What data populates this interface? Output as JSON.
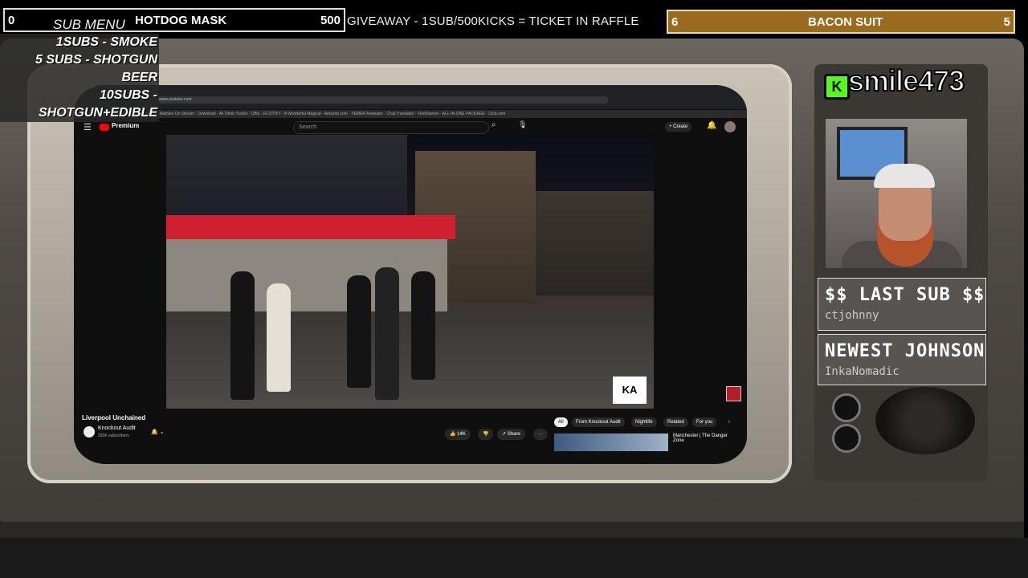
{
  "overlay": {
    "top_left": {
      "count": "0",
      "title": "HOTDOG MASK",
      "goal": "500",
      "submenu_title": "SUB MENU"
    },
    "submenu_items": [
      "1SUBS   - SMOKE",
      "5 SUBS  - SHOTGUN BEER",
      "10SUBS - SHOTGUN+EDIBLE"
    ],
    "ticker": "GIVEAWAY - 1SUB/500KICKS = TICKET IN RAFFLE",
    "top_right": {
      "count": "6",
      "title": "BACON SUIT",
      "goal": "5"
    },
    "streamer_name": "smile473",
    "kick_logo": "K",
    "last_sub": {
      "heading": "$$ LAST SUB $$",
      "name": "ctjohnny"
    },
    "newest": {
      "heading": "NEWEST JOHNSON",
      "name": "InkaNomadic"
    }
  },
  "browser": {
    "url": "www.youtube.com",
    "bookmarks": "Creator Dashboard · Neppis: The magic of · Marbles On Stream · Download · All Other Tracks · OBS · ECOTIXY · A Wonderful Magical · Amazon.com · YEMEN Repeater · Chat Translator · FirstOpener · ALL-IN-ONE PACKAGE · Club.com"
  },
  "youtube": {
    "logo_text": "Premium",
    "search_placeholder": "Search",
    "create_label": "+ Create",
    "video_badge": "KA",
    "video_title": "Liverpool Unchained",
    "channel_name": "Knockout Audit",
    "channel_subs": "293K subscribers",
    "likes": "14K",
    "share_label": "Share",
    "more_label": "···",
    "chips": [
      "All",
      "From Knockout Audit",
      "Nightlife",
      "Related",
      "For you"
    ],
    "chips_next": "›",
    "next_video_title": "Manchester | The Danger Zone"
  },
  "icons": {
    "menu": "hamburger-icon",
    "search": "search-icon",
    "mic": "mic-icon",
    "bell": "bell-icon"
  }
}
